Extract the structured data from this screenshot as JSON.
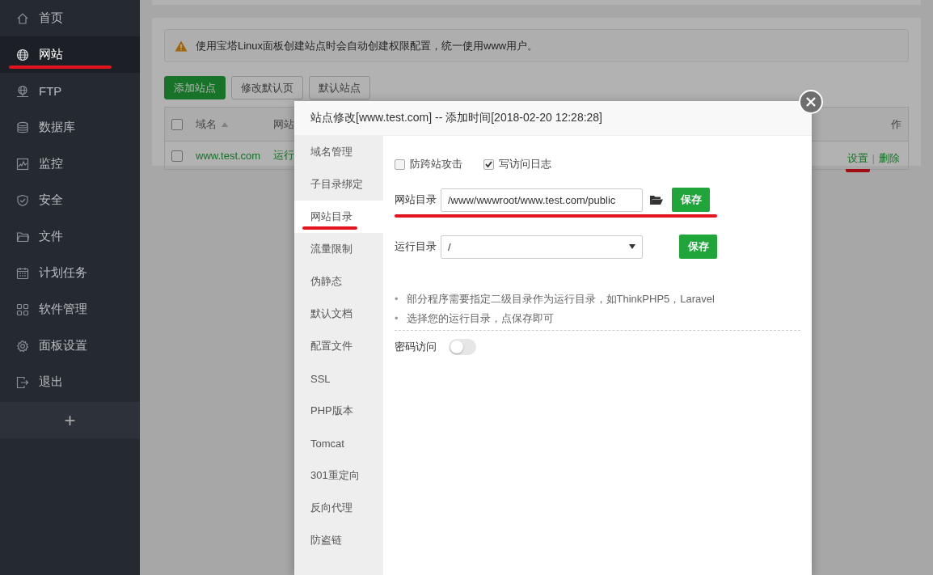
{
  "sidebar": {
    "items": [
      {
        "label": "首页",
        "selected": false,
        "underlined": false
      },
      {
        "label": "网站",
        "selected": true,
        "underlined": true
      },
      {
        "label": "FTP",
        "selected": false,
        "underlined": false
      },
      {
        "label": "数据库",
        "selected": false,
        "underlined": false
      },
      {
        "label": "监控",
        "selected": false,
        "underlined": false
      },
      {
        "label": "安全",
        "selected": false,
        "underlined": false
      },
      {
        "label": "文件",
        "selected": false,
        "underlined": false
      },
      {
        "label": "计划任务",
        "selected": false,
        "underlined": false
      },
      {
        "label": "软件管理",
        "selected": false,
        "underlined": false
      },
      {
        "label": "面板设置",
        "selected": false,
        "underlined": false
      },
      {
        "label": "退出",
        "selected": false,
        "underlined": false
      }
    ],
    "add_button": "+"
  },
  "notice": {
    "text": "使用宝塔Linux面板创建站点时会自动创建权限配置，统一使用www用户。"
  },
  "toolbar": {
    "buttons": [
      {
        "label": "添加站点",
        "primary": true
      },
      {
        "label": "修改默认页",
        "primary": false
      },
      {
        "label": "默认站点",
        "primary": false
      }
    ]
  },
  "table": {
    "header_checked": false,
    "columns": [
      {
        "label": "域名",
        "sorted": true
      },
      {
        "label": "网站",
        "sorted": false
      },
      {
        "label": "作",
        "sorted": false
      }
    ],
    "rows": [
      {
        "checked": false,
        "domain": "www.test.com",
        "status": "运行",
        "actions": [
          {
            "label": "设置",
            "underlined": true
          },
          {
            "label": "删除",
            "underlined": false
          }
        ],
        "separator": "|"
      }
    ]
  },
  "modal": {
    "title": "站点修改[www.test.com] -- 添加时间[2018-02-20 12:28:28]",
    "tabs": [
      {
        "label": "域名管理",
        "selected": false,
        "underlined": false
      },
      {
        "label": "子目录绑定",
        "selected": false,
        "underlined": false
      },
      {
        "label": "网站目录",
        "selected": true,
        "underlined": true
      },
      {
        "label": "流量限制",
        "selected": false,
        "underlined": false
      },
      {
        "label": "伪静态",
        "selected": false,
        "underlined": false
      },
      {
        "label": "默认文档",
        "selected": false,
        "underlined": false
      },
      {
        "label": "配置文件",
        "selected": false,
        "underlined": false
      },
      {
        "label": "SSL",
        "selected": false,
        "underlined": false
      },
      {
        "label": "PHP版本",
        "selected": false,
        "underlined": false
      },
      {
        "label": "Tomcat",
        "selected": false,
        "underlined": false
      },
      {
        "label": "301重定向",
        "selected": false,
        "underlined": false
      },
      {
        "label": "反向代理",
        "selected": false,
        "underlined": false
      },
      {
        "label": "防盗链",
        "selected": false,
        "underlined": false
      }
    ],
    "options": [
      {
        "label": "防跨站攻击",
        "checked": false
      },
      {
        "label": "写访问日志",
        "checked": true
      }
    ],
    "site_dir": {
      "label": "网站目录",
      "value": "/www/wwwroot/www.test.com/public",
      "button": "保存",
      "underlined": true
    },
    "run_dir": {
      "label": "运行目录",
      "value": "/",
      "button": "保存"
    },
    "tips": [
      {
        "marker": "•",
        "text": "部分程序需要指定二级目录作为运行目录，如ThinkPHP5，Laravel"
      },
      {
        "marker": "•",
        "text": "选择您的运行目录，点保存即可"
      }
    ],
    "password_access": {
      "label": "密码访问",
      "on": false
    }
  }
}
